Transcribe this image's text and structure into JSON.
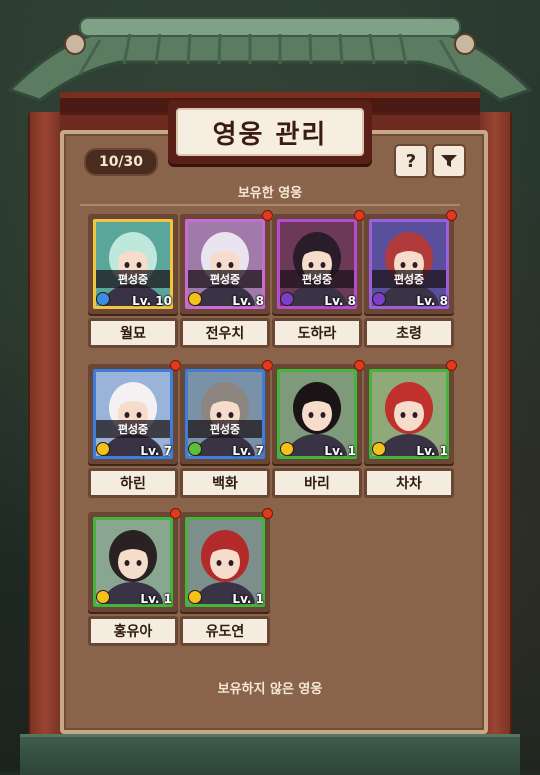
{
  "header": {
    "title": "영웅 관리",
    "count": "10/30",
    "help_label": "?"
  },
  "sections": {
    "owned": "보유한 영웅",
    "not_owned": "보유하지 않은 영웅"
  },
  "heroes": [
    {
      "name": "월묘",
      "level": "Lv. 10",
      "equipped": "편성중",
      "rarity": "legendary",
      "frame": "#f2c53d",
      "bg": "#5aa69a",
      "hair": "#bfe8dc",
      "coin": "#3b8ee0",
      "notif": false
    },
    {
      "name": "전우치",
      "level": "Lv. 8",
      "equipped": "편성중",
      "rarity": "epic",
      "frame": "#c96ad6",
      "bg": "#a07aa8",
      "hair": "#e9e4ef",
      "coin": "#f3c21a",
      "notif": true
    },
    {
      "name": "도하라",
      "level": "Lv. 8",
      "equipped": "편성중",
      "rarity": "epic",
      "frame": "#b64ad0",
      "bg": "#6c3a58",
      "hair": "#2a1d2a",
      "coin": "#7a3fc9",
      "notif": true
    },
    {
      "name": "초령",
      "level": "Lv. 8",
      "equipped": "편성중",
      "rarity": "epic",
      "frame": "#9c5fe0",
      "bg": "#5a4f9c",
      "hair": "#b13a3a",
      "coin": "#7a3fc9",
      "notif": true
    },
    {
      "name": "하린",
      "level": "Lv. 7",
      "equipped": "편성중",
      "rarity": "rare",
      "frame": "#3b7ee0",
      "bg": "#9ab3d8",
      "hair": "#f3f1f2",
      "coin": "#f3c21a",
      "notif": true
    },
    {
      "name": "백화",
      "level": "Lv. 7",
      "equipped": "편성중",
      "rarity": "rare",
      "frame": "#3b7ee0",
      "bg": "#7a92a8",
      "hair": "#8c8580",
      "coin": "#59c23a",
      "notif": true
    },
    {
      "name": "바리",
      "level": "Lv. 1",
      "equipped": "",
      "rarity": "common",
      "frame": "#44b53c",
      "bg": "#7e9a7a",
      "hair": "#1a1416",
      "coin": "#f3c21a",
      "notif": true
    },
    {
      "name": "차차",
      "level": "Lv. 1",
      "equipped": "",
      "rarity": "common",
      "frame": "#44b53c",
      "bg": "#8fa978",
      "hair": "#c0302c",
      "coin": "#f3c21a",
      "notif": true
    },
    {
      "name": "홍유아",
      "level": "Lv. 1",
      "equipped": "",
      "rarity": "common",
      "frame": "#44b53c",
      "bg": "#89a690",
      "hair": "#2a2222",
      "coin": "#f3c21a",
      "notif": true
    },
    {
      "name": "유도연",
      "level": "Lv. 1",
      "equipped": "",
      "rarity": "common",
      "frame": "#44b53c",
      "bg": "#7d8f8a",
      "hair": "#b32a2a",
      "coin": "#f3c21a",
      "notif": true
    }
  ]
}
